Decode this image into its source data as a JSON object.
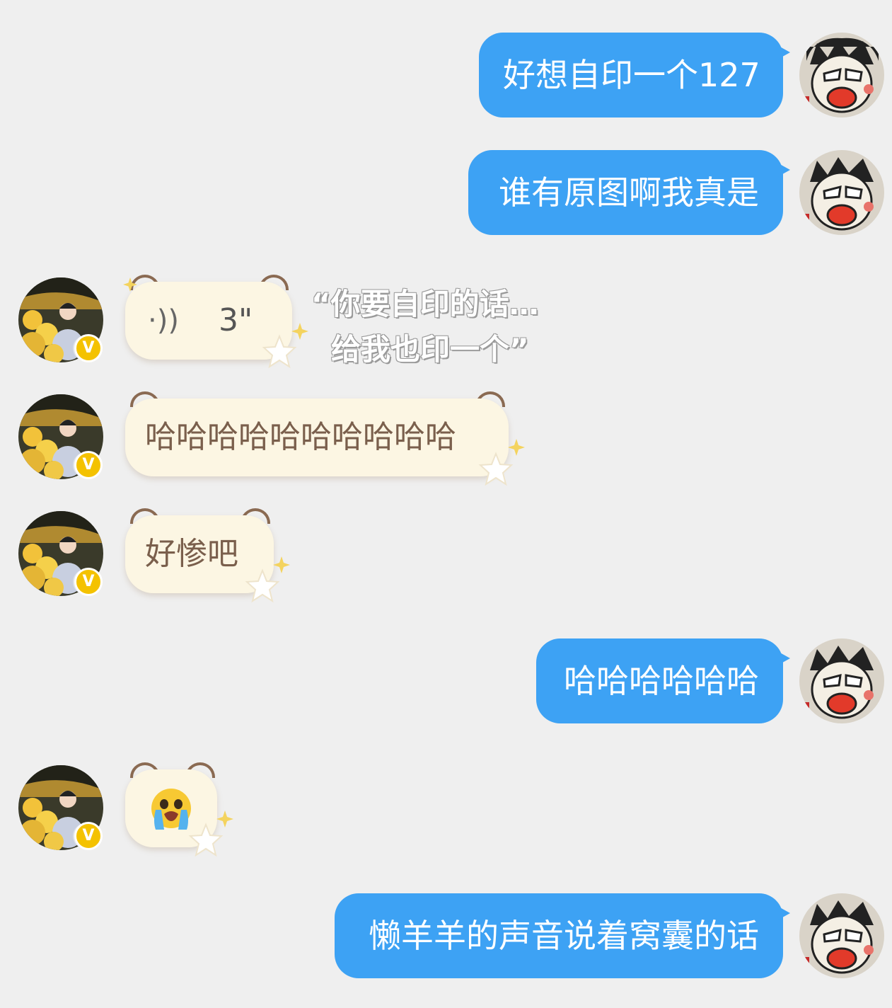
{
  "messages": {
    "m1": "好想自印一个127",
    "m2": "谁有原图啊我真是",
    "voice_duration": "3\"",
    "m4": "哈哈哈哈哈哈哈哈哈哈",
    "m5": "好惨吧",
    "m6": "哈哈哈哈哈哈",
    "m7_emoji": "😭",
    "m8": "懒羊羊的声音说着窝囊的话"
  },
  "overlay": {
    "line1": "“你要自印的话…",
    "line2": "给我也印一个”"
  },
  "badge": {
    "letter": "V"
  },
  "colors": {
    "background": "#efefef",
    "outgoing_bubble": "#3da2f4",
    "incoming_bubble": "#fcf6e3",
    "incoming_text": "#7a5f4c",
    "badge": "#f4c200"
  }
}
